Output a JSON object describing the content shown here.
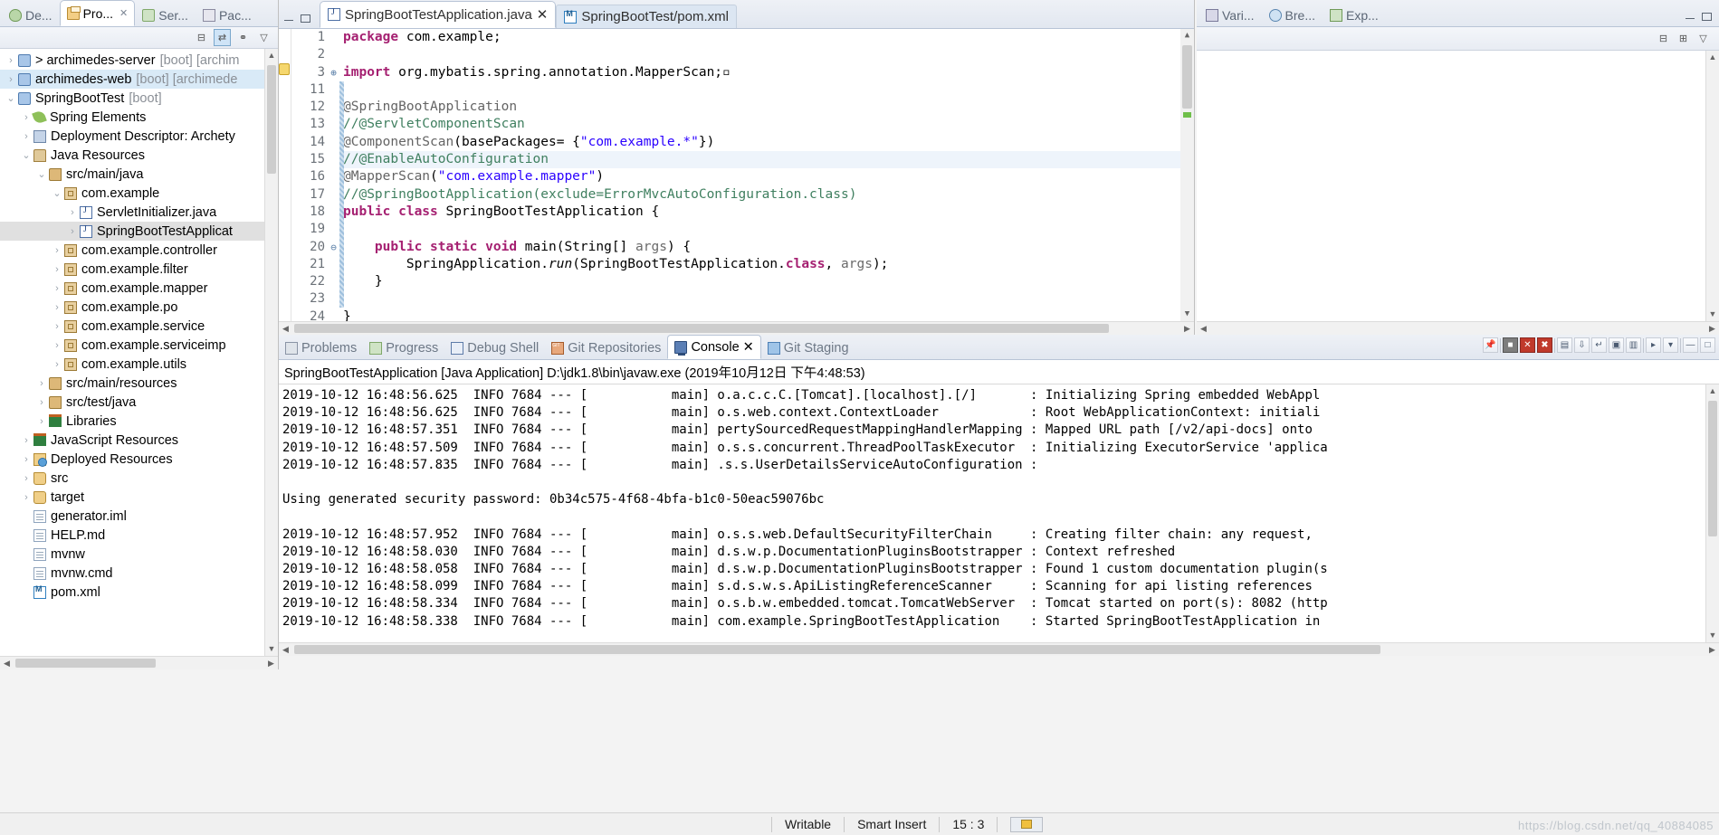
{
  "left_panel": {
    "view_tabs": [
      {
        "label": "De...",
        "icon": "bug-icon",
        "active": false
      },
      {
        "label": "Pro...",
        "icon": "project-explorer-icon",
        "active": true
      },
      {
        "label": "Ser...",
        "icon": "servers-icon",
        "active": false
      },
      {
        "label": "Pac...",
        "icon": "package-explorer-icon",
        "active": false
      }
    ],
    "toolbar": [
      {
        "name": "collapse-all-button",
        "glyph": "⊟"
      },
      {
        "name": "link-with-editor-button",
        "glyph": "⇄"
      },
      {
        "name": "focus-active-task-button",
        "glyph": "⚭"
      },
      {
        "name": "view-menu-button",
        "glyph": "▽"
      }
    ],
    "tree": [
      {
        "indent": 0,
        "arrow": "›",
        "icon": "maven-project-icon",
        "label": "> archimedes-server",
        "suffix": "[boot] [archim",
        "state": "normal"
      },
      {
        "indent": 0,
        "arrow": "›",
        "icon": "maven-project-icon",
        "label": "archimedes-web",
        "suffix": "[boot] [archimede",
        "state": "selected"
      },
      {
        "indent": 0,
        "arrow": "⌄",
        "icon": "spring-project-icon",
        "label": "SpringBootTest",
        "suffix": "[boot]",
        "state": "normal"
      },
      {
        "indent": 1,
        "arrow": "›",
        "icon": "spring-leaf-icon",
        "label": "Spring Elements",
        "suffix": "",
        "state": "normal"
      },
      {
        "indent": 1,
        "arrow": "›",
        "icon": "deployment-descriptor-icon",
        "label": "Deployment Descriptor: Archety",
        "suffix": "",
        "state": "normal"
      },
      {
        "indent": 1,
        "arrow": "⌄",
        "icon": "java-resources-icon",
        "label": "Java Resources",
        "suffix": "",
        "state": "normal"
      },
      {
        "indent": 2,
        "arrow": "⌄",
        "icon": "source-folder-icon",
        "label": "src/main/java",
        "suffix": "",
        "state": "normal"
      },
      {
        "indent": 3,
        "arrow": "⌄",
        "icon": "package-icon",
        "label": "com.example",
        "suffix": "",
        "state": "normal"
      },
      {
        "indent": 4,
        "arrow": "›",
        "icon": "java-file-icon",
        "label": "ServletInitializer.java",
        "suffix": "",
        "state": "normal"
      },
      {
        "indent": 4,
        "arrow": "›",
        "icon": "java-file-warning-icon",
        "label": "SpringBootTestApplicat",
        "suffix": "",
        "state": "selected-gray"
      },
      {
        "indent": 3,
        "arrow": "›",
        "icon": "package-icon",
        "label": "com.example.controller",
        "suffix": "",
        "state": "normal"
      },
      {
        "indent": 3,
        "arrow": "›",
        "icon": "package-icon",
        "label": "com.example.filter",
        "suffix": "",
        "state": "normal"
      },
      {
        "indent": 3,
        "arrow": "›",
        "icon": "package-icon",
        "label": "com.example.mapper",
        "suffix": "",
        "state": "normal"
      },
      {
        "indent": 3,
        "arrow": "›",
        "icon": "package-icon",
        "label": "com.example.po",
        "suffix": "",
        "state": "normal"
      },
      {
        "indent": 3,
        "arrow": "›",
        "icon": "package-icon",
        "label": "com.example.service",
        "suffix": "",
        "state": "normal"
      },
      {
        "indent": 3,
        "arrow": "›",
        "icon": "package-icon",
        "label": "com.example.serviceimp",
        "suffix": "",
        "state": "normal"
      },
      {
        "indent": 3,
        "arrow": "›",
        "icon": "package-icon",
        "label": "com.example.utils",
        "suffix": "",
        "state": "normal"
      },
      {
        "indent": 2,
        "arrow": "›",
        "icon": "source-folder-icon",
        "label": "src/main/resources",
        "suffix": "",
        "state": "normal"
      },
      {
        "indent": 2,
        "arrow": "›",
        "icon": "source-folder-icon",
        "label": "src/test/java",
        "suffix": "",
        "state": "normal"
      },
      {
        "indent": 2,
        "arrow": "›",
        "icon": "libraries-icon",
        "label": "Libraries",
        "suffix": "",
        "state": "normal"
      },
      {
        "indent": 1,
        "arrow": "›",
        "icon": "libraries-icon",
        "label": "JavaScript Resources",
        "suffix": "",
        "state": "normal"
      },
      {
        "indent": 1,
        "arrow": "›",
        "icon": "deployed-resources-icon",
        "label": "Deployed Resources",
        "suffix": "",
        "state": "normal"
      },
      {
        "indent": 1,
        "arrow": "›",
        "icon": "folder-icon",
        "label": "src",
        "suffix": "",
        "state": "normal"
      },
      {
        "indent": 1,
        "arrow": "›",
        "icon": "folder-icon",
        "label": "target",
        "suffix": "",
        "state": "normal"
      },
      {
        "indent": 1,
        "arrow": "",
        "icon": "file-icon",
        "label": "generator.iml",
        "suffix": "",
        "state": "normal"
      },
      {
        "indent": 1,
        "arrow": "",
        "icon": "file-icon",
        "label": "HELP.md",
        "suffix": "",
        "state": "normal"
      },
      {
        "indent": 1,
        "arrow": "",
        "icon": "file-icon",
        "label": "mvnw",
        "suffix": "",
        "state": "normal"
      },
      {
        "indent": 1,
        "arrow": "",
        "icon": "file-icon",
        "label": "mvnw.cmd",
        "suffix": "",
        "state": "normal"
      },
      {
        "indent": 1,
        "arrow": "",
        "icon": "maven-pom-icon",
        "label": "pom.xml",
        "suffix": "",
        "state": "normal"
      }
    ]
  },
  "editor": {
    "tabs": [
      {
        "label": "SpringBootTestApplication.java",
        "icon": "java-file-warning-icon",
        "active": true,
        "closable": true
      },
      {
        "label": "SpringBootTest/pom.xml",
        "icon": "maven-pom-icon",
        "active": false,
        "closable": false
      }
    ],
    "window_controls": {
      "minimize": "minimize-icon",
      "maximize": "maximize-icon"
    },
    "lines": [
      {
        "num": "1",
        "marker": "",
        "fold": "",
        "highlight": false,
        "tokens": [
          {
            "t": "package ",
            "c": "kw"
          },
          {
            "t": "com.example;",
            "c": "plain"
          }
        ]
      },
      {
        "num": "2",
        "marker": "",
        "fold": "",
        "highlight": false,
        "tokens": []
      },
      {
        "num": "3",
        "marker": "warn",
        "fold": "+",
        "highlight": false,
        "tokens": [
          {
            "t": "import ",
            "c": "kw"
          },
          {
            "t": "org.mybatis.spring.annotation.MapperScan;",
            "c": "plain"
          },
          {
            "t": "▫",
            "c": "plain"
          }
        ]
      },
      {
        "num": "11",
        "marker": "",
        "fold": "",
        "highlight": false,
        "tokens": []
      },
      {
        "num": "12",
        "marker": "",
        "fold": "",
        "highlight": false,
        "tokens": [
          {
            "t": "@SpringBootApplication",
            "c": "anno"
          }
        ]
      },
      {
        "num": "13",
        "marker": "",
        "fold": "",
        "highlight": false,
        "tokens": [
          {
            "t": "//@ServletComponentScan",
            "c": "cmt"
          }
        ]
      },
      {
        "num": "14",
        "marker": "",
        "fold": "",
        "highlight": false,
        "tokens": [
          {
            "t": "@ComponentScan",
            "c": "anno"
          },
          {
            "t": "(basePackages= {",
            "c": "plain"
          },
          {
            "t": "\"com.example.*\"",
            "c": "str"
          },
          {
            "t": "})",
            "c": "plain"
          }
        ]
      },
      {
        "num": "15",
        "marker": "",
        "fold": "",
        "highlight": true,
        "tokens": [
          {
            "t": "//@EnableAutoConfiguration",
            "c": "cmt"
          }
        ]
      },
      {
        "num": "16",
        "marker": "",
        "fold": "",
        "highlight": false,
        "tokens": [
          {
            "t": "@MapperScan",
            "c": "anno"
          },
          {
            "t": "(",
            "c": "plain"
          },
          {
            "t": "\"com.example.mapper\"",
            "c": "str"
          },
          {
            "t": ")",
            "c": "plain"
          }
        ]
      },
      {
        "num": "17",
        "marker": "",
        "fold": "",
        "highlight": false,
        "tokens": [
          {
            "t": "//@SpringBootApplication(exclude=ErrorMvcAutoConfiguration.class)",
            "c": "cmt"
          }
        ]
      },
      {
        "num": "18",
        "marker": "",
        "fold": "",
        "highlight": false,
        "tokens": [
          {
            "t": "public class ",
            "c": "kw"
          },
          {
            "t": "SpringBootTestApplication {",
            "c": "plain"
          }
        ]
      },
      {
        "num": "19",
        "marker": "",
        "fold": "",
        "highlight": false,
        "tokens": []
      },
      {
        "num": "20",
        "marker": "",
        "fold": "-",
        "highlight": false,
        "tokens": [
          {
            "t": "    public static void ",
            "c": "kw"
          },
          {
            "t": "main(String[] ",
            "c": "plain"
          },
          {
            "t": "args",
            "c": "arg"
          },
          {
            "t": ") {",
            "c": "plain"
          }
        ]
      },
      {
        "num": "21",
        "marker": "",
        "fold": "",
        "highlight": false,
        "tokens": [
          {
            "t": "        SpringApplication.",
            "c": "plain"
          },
          {
            "t": "run",
            "c": "ital"
          },
          {
            "t": "(SpringBootTestApplication.",
            "c": "plain"
          },
          {
            "t": "class",
            "c": "kw"
          },
          {
            "t": ", ",
            "c": "plain"
          },
          {
            "t": "args",
            "c": "arg"
          },
          {
            "t": ");",
            "c": "plain"
          }
        ]
      },
      {
        "num": "22",
        "marker": "",
        "fold": "",
        "highlight": false,
        "tokens": [
          {
            "t": "    }",
            "c": "plain"
          }
        ]
      },
      {
        "num": "23",
        "marker": "",
        "fold": "",
        "highlight": false,
        "tokens": []
      },
      {
        "num": "24",
        "marker": "",
        "fold": "",
        "highlight": false,
        "tokens": [
          {
            "t": "}",
            "c": "plain"
          }
        ]
      }
    ]
  },
  "right_panel": {
    "tabs": [
      {
        "label": "Vari...",
        "icon": "variables-icon",
        "active": false
      },
      {
        "label": "Bre...",
        "icon": "breakpoints-icon",
        "active": false
      },
      {
        "label": "Exp...",
        "icon": "expressions-icon",
        "active": false
      }
    ],
    "toolbar": [
      {
        "name": "collapse-all-button",
        "glyph": "⊟"
      },
      {
        "name": "show-logical-structure-button",
        "glyph": "⊞"
      },
      {
        "name": "view-menu-button",
        "glyph": "▽"
      }
    ]
  },
  "console_panel": {
    "tabs": [
      {
        "label": "Problems",
        "icon": "problems-icon",
        "active": false,
        "closable": false
      },
      {
        "label": "Progress",
        "icon": "progress-icon",
        "active": false,
        "closable": false
      },
      {
        "label": "Debug Shell",
        "icon": "debug-shell-icon",
        "active": false,
        "closable": false
      },
      {
        "label": "Git Repositories",
        "icon": "git-repositories-icon",
        "active": false,
        "closable": false
      },
      {
        "label": "Console",
        "icon": "console-icon",
        "active": true,
        "closable": true
      },
      {
        "label": "Git Staging",
        "icon": "git-staging-icon",
        "active": false,
        "closable": false
      }
    ],
    "toolbar_buttons": [
      {
        "name": "pin-console-button",
        "glyph": "📌"
      },
      {
        "name": "terminate-button",
        "glyph": "■"
      },
      {
        "name": "remove-launch-button",
        "glyph": "✕"
      },
      {
        "name": "remove-all-terminated-button",
        "glyph": "✖"
      },
      {
        "name": "clear-console-button",
        "glyph": "▤"
      },
      {
        "name": "scroll-lock-button",
        "glyph": "⇩"
      },
      {
        "name": "word-wrap-button",
        "glyph": "↵"
      },
      {
        "name": "show-console-on-output-button",
        "glyph": "▣"
      },
      {
        "name": "pin-console-2-button",
        "glyph": "▥"
      },
      {
        "name": "display-selected-console-button",
        "glyph": "▸"
      },
      {
        "name": "open-console-button",
        "glyph": "▾"
      },
      {
        "name": "minimize-panel-button",
        "glyph": "—"
      },
      {
        "name": "maximize-panel-button",
        "glyph": "□"
      }
    ],
    "title": "SpringBootTestApplication [Java Application] D:\\jdk1.8\\bin\\javaw.exe (2019年10月12日 下午4:48:53)",
    "log_lines": [
      "2019-10-12 16:48:56.625  INFO 7684 --- [           main] o.a.c.c.C.[Tomcat].[localhost].[/]       : Initializing Spring embedded WebAppl",
      "2019-10-12 16:48:56.625  INFO 7684 --- [           main] o.s.web.context.ContextLoader            : Root WebApplicationContext: initiali",
      "2019-10-12 16:48:57.351  INFO 7684 --- [           main] pertySourcedRequestMappingHandlerMapping : Mapped URL path [/v2/api-docs] onto ",
      "2019-10-12 16:48:57.509  INFO 7684 --- [           main] o.s.s.concurrent.ThreadPoolTaskExecutor  : Initializing ExecutorService 'applica",
      "2019-10-12 16:48:57.835  INFO 7684 --- [           main] .s.s.UserDetailsServiceAutoConfiguration :",
      "",
      "Using generated security password: 0b34c575-4f68-4bfa-b1c0-50eac59076bc",
      "",
      "2019-10-12 16:48:57.952  INFO 7684 --- [           main] o.s.s.web.DefaultSecurityFilterChain     : Creating filter chain: any request, ",
      "2019-10-12 16:48:58.030  INFO 7684 --- [           main] d.s.w.p.DocumentationPluginsBootstrapper : Context refreshed",
      "2019-10-12 16:48:58.058  INFO 7684 --- [           main] d.s.w.p.DocumentationPluginsBootstrapper : Found 1 custom documentation plugin(s",
      "2019-10-12 16:48:58.099  INFO 7684 --- [           main] s.d.s.w.s.ApiListingReferenceScanner     : Scanning for api listing references",
      "2019-10-12 16:48:58.334  INFO 7684 --- [           main] o.s.b.w.embedded.tomcat.TomcatWebServer  : Tomcat started on port(s): 8082 (http",
      "2019-10-12 16:48:58.338  INFO 7684 --- [           main] com.example.SpringBootTestApplication    : Started SpringBootTestApplication in "
    ]
  },
  "status_bar": {
    "writable": "Writable",
    "insert_mode": "Smart Insert",
    "cursor_position": "15 : 3",
    "lock_icon": "keyboard-lock-icon",
    "watermark": "https://blog.csdn.net/qq_40884085"
  },
  "colors": {
    "selection_blue": "#d9eaf7",
    "keyword": "#a52071",
    "string": "#2a00ff",
    "comment": "#3f7f5f",
    "annotation": "#646464",
    "tab_active_bg": "#ffffff"
  }
}
